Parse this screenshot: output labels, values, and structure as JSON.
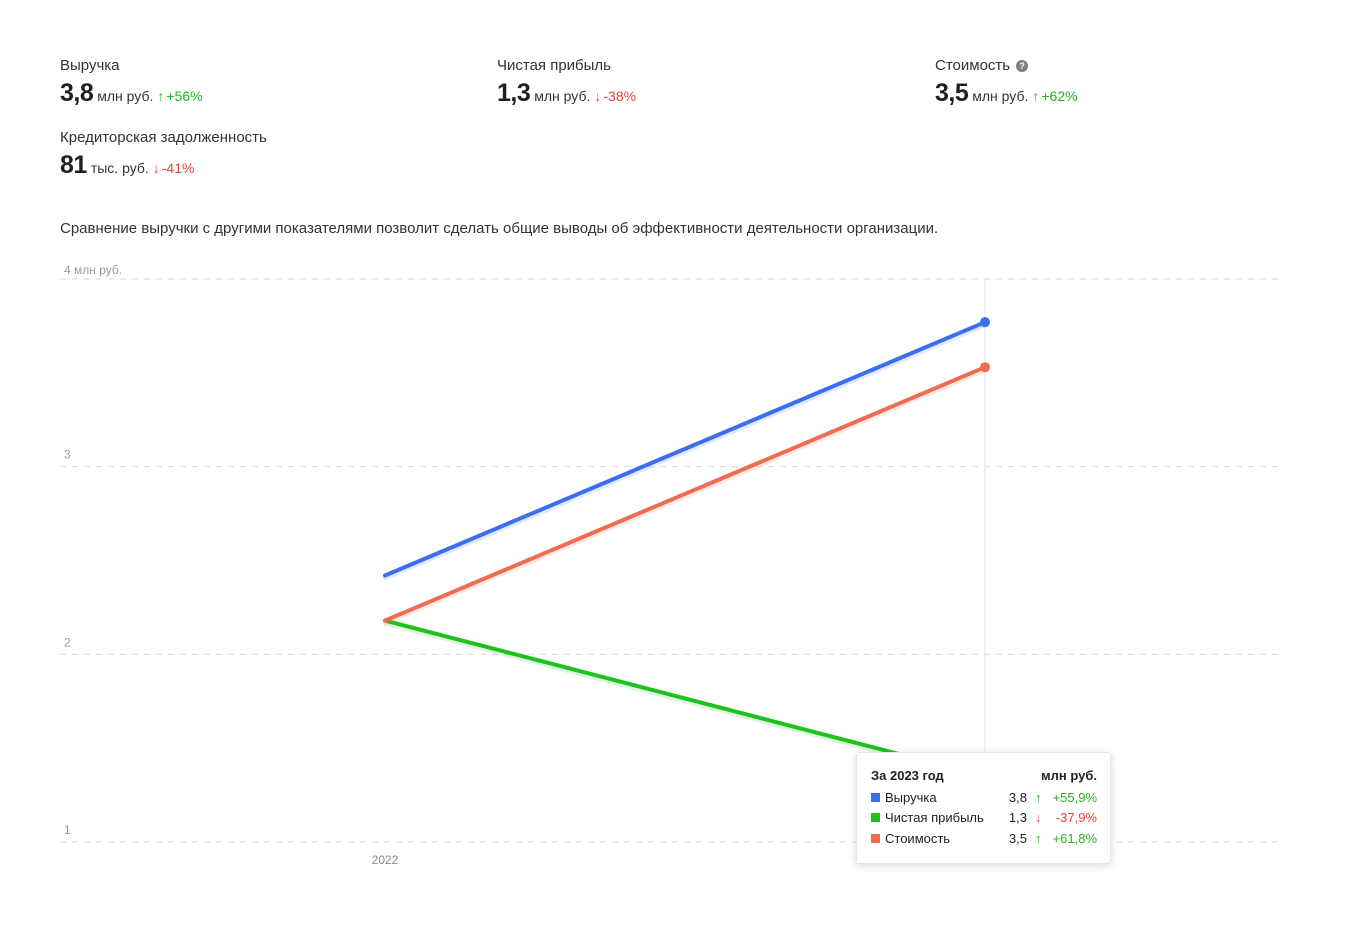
{
  "metrics": [
    {
      "label": "Выручка",
      "value": "3,8",
      "unit": "млн руб.",
      "direction": "up",
      "change": "+56%"
    },
    {
      "label": "Чистая прибыль",
      "value": "1,3",
      "unit": "млн руб.",
      "direction": "down",
      "change": "-38%"
    },
    {
      "label": "Стоимость",
      "value": "3,5",
      "unit": "млн руб.",
      "direction": "up",
      "change": "+62%",
      "icon": "help-icon"
    },
    {
      "label": "Кредиторская задолженность",
      "value": "81",
      "unit": "тыс. руб.",
      "direction": "down",
      "change": "-41%"
    }
  ],
  "arrows": {
    "up": "↑",
    "down": "↓"
  },
  "description": "Сравнение выручки с другими показателями позволит сделать общие выводы об эффективности деятельности организации.",
  "chart_data": {
    "type": "line",
    "ylabel": "4 млн руб.",
    "y_ticks": [
      1,
      2,
      3
    ],
    "ylim": [
      1,
      4
    ],
    "x": [
      "2022",
      "2023"
    ],
    "x_tick_labels": [
      "2022",
      ""
    ],
    "grid": true,
    "series": [
      {
        "name": "Выручка",
        "color": "#3b6ef0",
        "values": [
          2.42,
          3.77
        ]
      },
      {
        "name": "Чистая прибыль",
        "color": "#1ec11e",
        "values": [
          2.18,
          1.35
        ]
      },
      {
        "name": "Стоимость",
        "color": "#f06b4f",
        "values": [
          2.18,
          3.53
        ]
      }
    ],
    "highlight_index": 1
  },
  "tooltip": {
    "title": "За 2023 год",
    "unit": "млн руб.",
    "rows": [
      {
        "name": "Выручка",
        "color": "#3b6ef0",
        "value": "3,8",
        "direction": "up",
        "change": "+55,9%"
      },
      {
        "name": "Чистая прибыль",
        "color": "#1ec11e",
        "value": "1,3",
        "direction": "down",
        "change": "-37,9%"
      },
      {
        "name": "Стоимость",
        "color": "#f06b4f",
        "value": "3,5",
        "direction": "up",
        "change": "+61,8%"
      }
    ]
  }
}
